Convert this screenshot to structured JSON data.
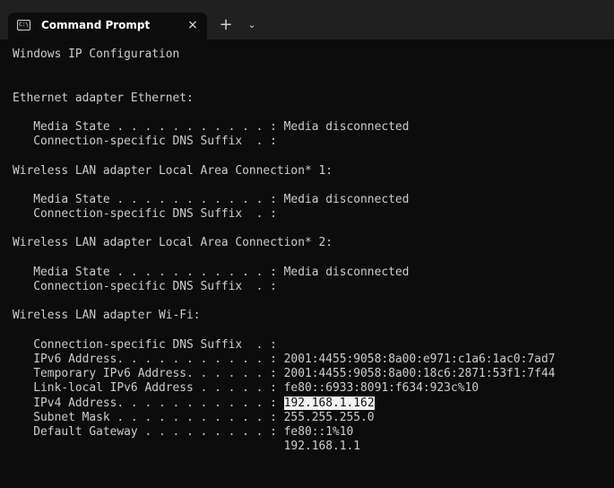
{
  "window": {
    "tab_title": "Command Prompt",
    "tab_icon_text": "C:\\",
    "close_glyph": "×",
    "new_tab_glyph": "+",
    "dropdown_glyph": "⌄"
  },
  "terminal": {
    "lines": [
      "Windows IP Configuration",
      "",
      "",
      "Ethernet adapter Ethernet:",
      "",
      "   Media State . . . . . . . . . . . : Media disconnected",
      "   Connection-specific DNS Suffix  . :",
      "",
      "Wireless LAN adapter Local Area Connection* 1:",
      "",
      "   Media State . . . . . . . . . . . : Media disconnected",
      "   Connection-specific DNS Suffix  . :",
      "",
      "Wireless LAN adapter Local Area Connection* 2:",
      "",
      "   Media State . . . . . . . . . . . : Media disconnected",
      "   Connection-specific DNS Suffix  . :",
      "",
      "Wireless LAN adapter Wi-Fi:",
      "",
      "   Connection-specific DNS Suffix  . :",
      "   IPv6 Address. . . . . . . . . . . : 2001:4455:9058:8a00:e971:c1a6:1ac0:7ad7",
      "   Temporary IPv6 Address. . . . . . : 2001:4455:9058:8a00:18c6:2871:53f1:7f44",
      "   Link-local IPv6 Address . . . . . : fe80::6933:8091:f634:923c%10",
      "   IPv4 Address. . . . . . . . . . . : ",
      "   Subnet Mask . . . . . . . . . . . : 255.255.255.0",
      "   Default Gateway . . . . . . . . . : fe80::1%10",
      "                                       192.168.1.1"
    ],
    "selected_value": "192.168.1.162",
    "selected_line_index": 24
  },
  "colors": {
    "terminal_background": "#0c0c0c",
    "titlebar_background": "#202020",
    "text": "#cccccc",
    "selection_background": "#f2f2f2"
  }
}
